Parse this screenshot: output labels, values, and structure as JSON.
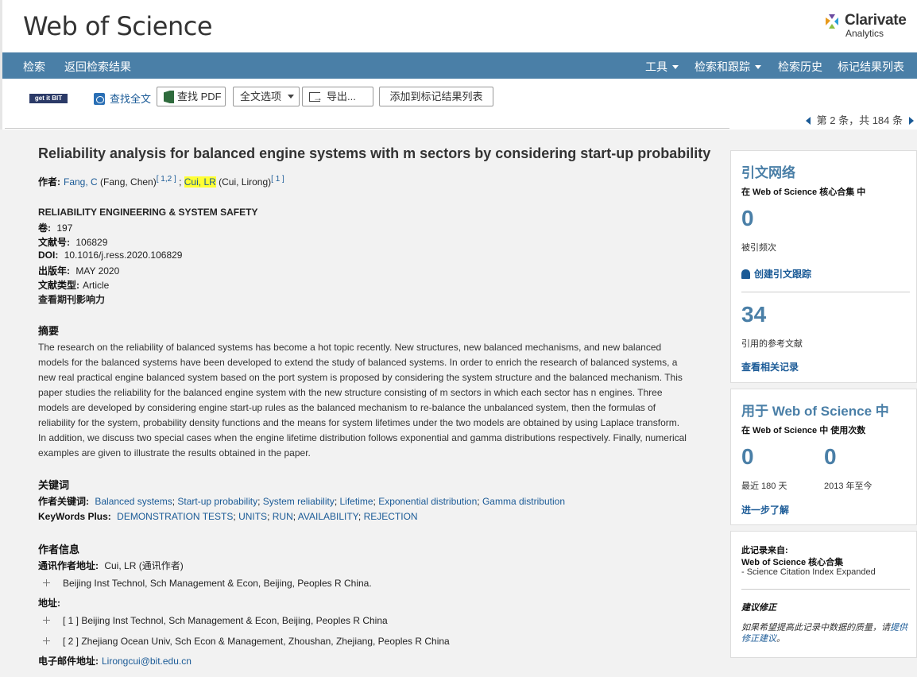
{
  "header": {
    "logo": "Web of Science",
    "brand_name": "Clarivate",
    "brand_sub": "Analytics"
  },
  "nav": {
    "search": "检索",
    "back": "返回检索结果",
    "tools": "工具",
    "search_track": "检索和跟踪",
    "history": "检索历史",
    "marked": "标记结果列表"
  },
  "toolbar": {
    "getit": "get it BIT",
    "fulltext": "查找全文",
    "pdf": "查找 PDF",
    "options": "全文选项",
    "export": "导出...",
    "add_marked": "添加到标记结果列表",
    "pager": "第 2 条，共 184 条"
  },
  "record": {
    "title": "Reliability analysis for balanced engine systems with m sectors by considering start-up probability",
    "authors_label": "作者:",
    "author1": "Fang, C",
    "author1_full": " (Fang, Chen)",
    "author1_refs": "[ 1,2 ]",
    "sep": " ; ",
    "author2": "Cui, LR",
    "author2_full": " (Cui, Lirong)",
    "author2_refs": "[ 1 ]",
    "journal": "RELIABILITY ENGINEERING & SYSTEM SAFETY",
    "volume_label": "卷:",
    "volume": "197",
    "article_label": "文献号:",
    "article": "106829",
    "doi_label": "DOI:",
    "doi": "10.1016/j.ress.2020.106829",
    "year_label": "出版年:",
    "year": "MAY 2020",
    "type_label": "文献类型:",
    "type": "Article",
    "impact_link": "查看期刊影响力",
    "abstract_heading": "摘要",
    "abstract": "The research on the reliability of balanced systems has become a hot topic recently. New structures, new balanced mechanisms, and new balanced models for the balanced systems have been developed to extend the study of balanced systems. In order to enrich the research of balanced systems, a new real practical engine balanced system based on the port system is proposed by considering the system structure and the balanced mechanism. This paper studies the reliability for the balanced engine system with the new structure consisting of m sectors in which each sector has n engines. Three models are developed by considering engine start-up rules as the balanced mechanism to re-balance the unbalanced system, then the formulas of reliability for the system, probability density functions and the means for system lifetimes under the two models are obtained by using Laplace transform. In addition, we discuss two special cases when the engine lifetime distribution follows exponential and gamma distributions respectively. Finally, numerical examples are given to illustrate the results obtained in the paper.",
    "keywords_heading": "关键词",
    "author_kw_label": "作者关键词:",
    "author_keywords": [
      "Balanced systems",
      "Start-up probability",
      "System reliability",
      "Lifetime",
      "Exponential distribution",
      "Gamma distribution"
    ],
    "kwplus_label": "KeyWords Plus:",
    "keywords_plus": [
      "DEMONSTRATION TESTS",
      "UNITS",
      "RUN",
      "AVAILABILITY",
      "REJECTION"
    ],
    "author_info_heading": "作者信息",
    "corr_label": "通讯作者地址:",
    "corr": "Cui, LR (通讯作者)",
    "corr_address": "Beijing Inst Technol, Sch Management & Econ, Beijing, Peoples R China.",
    "address_label": "地址:",
    "address1": "[ 1 ] Beijing Inst Technol, Sch Management & Econ, Beijing, Peoples R China",
    "address2": "[ 2 ] Zhejiang Ocean Univ, Sch Econ & Management, Zhoushan, Zhejiang, Peoples R China",
    "email_label": "电子邮件地址:",
    "email": "Lirongcui@bit.edu.cn"
  },
  "citation_card": {
    "title": "引文网络",
    "sub": "在 Web of Science 核心合集 中",
    "times_cited": "0",
    "times_cited_label": "被引频次",
    "create_alert": "创建引文跟踪",
    "refs": "34",
    "refs_label": "引用的参考文献",
    "related": "查看相关记录"
  },
  "usage_card": {
    "title": "用于 Web of Science 中",
    "sub": "在 Web of Science 中 使用次数",
    "last180": "0",
    "last180_label": "最近 180 天",
    "since2013": "0",
    "since2013_label": "2013 年至今",
    "learn_more": "进一步了解"
  },
  "source_card": {
    "from_label": "此记录来自:",
    "db": "Web of Science 核心合集",
    "index": "- Science Citation Index Expanded",
    "suggest_heading": "建议修正",
    "suggest_text": "如果希望提高此记录中数据的质量，请",
    "suggest_link": "提供修正建议",
    "suggest_end": "。"
  },
  "colors": {
    "nav_bg": "#4a7fa7",
    "link": "#1a5a96",
    "highlight": "#ffff33"
  }
}
